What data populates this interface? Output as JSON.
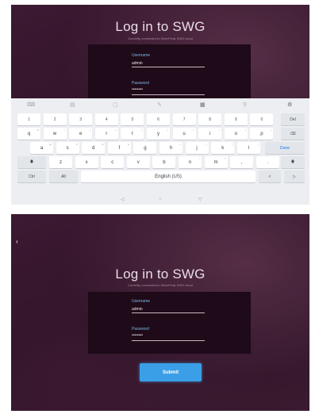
{
  "screen1": {
    "title": "Log in to SWG",
    "subtitle": "Currently connected to SilverPeak SWG cloud",
    "username_label": "Username",
    "username_value": "admin",
    "password_label": "Password",
    "password_value": "••••••••",
    "keyboard": {
      "toolbar_icons": [
        "keyboard-icon",
        "gif-icon",
        "clipboard-icon",
        "gear-icon",
        "palette-icon",
        "text-selection-icon",
        "settings-icon"
      ],
      "number_row": [
        "1",
        "2",
        "3",
        "4",
        "5",
        "6",
        "7",
        "8",
        "9",
        "0"
      ],
      "row_q": [
        "q",
        "w",
        "e",
        "r",
        "t",
        "y",
        "u",
        "i",
        "o",
        "p"
      ],
      "row_a": [
        "a",
        "s",
        "d",
        "f",
        "g",
        "h",
        "j",
        "k",
        "l"
      ],
      "row_z": [
        "z",
        "x",
        "c",
        "v",
        "b",
        "n",
        "m",
        ",",
        "."
      ],
      "row_q_hints": [
        "%",
        "\\",
        "|",
        "=",
        "[",
        "]",
        "<",
        ">",
        "{",
        "}"
      ],
      "row_a_hints": [
        "@",
        "#",
        "$",
        "&",
        "-",
        "+",
        "(",
        ")",
        "/"
      ],
      "row_z_hints": [
        "*",
        "\"",
        "'",
        ":",
        ";",
        "!",
        "?",
        "",
        ""
      ],
      "del_label": "Del",
      "done_label": "Done",
      "ctrl_label": "Ctrl",
      "alt_label": "Alt",
      "space_label": "English (US)",
      "left_arrow": "<",
      "right_arrow": "▷",
      "shift_symbol": "🡅",
      "backspace_symbol": "⌫"
    },
    "nav": {
      "back": "◁",
      "home": "○",
      "recents": "▽"
    }
  },
  "screen2": {
    "title": "Log in to SWG",
    "subtitle": "Currently connected to SilverPeak SWG cloud",
    "username_label": "Username",
    "username_value": "admin",
    "password_label": "Password",
    "password_value": "••••••••",
    "submit_label": "Submit",
    "back_arrow": "‹"
  },
  "colors": {
    "accent": "#3a9fe6",
    "label_blue": "#7fb9e8",
    "panel": "#1e0a18"
  }
}
